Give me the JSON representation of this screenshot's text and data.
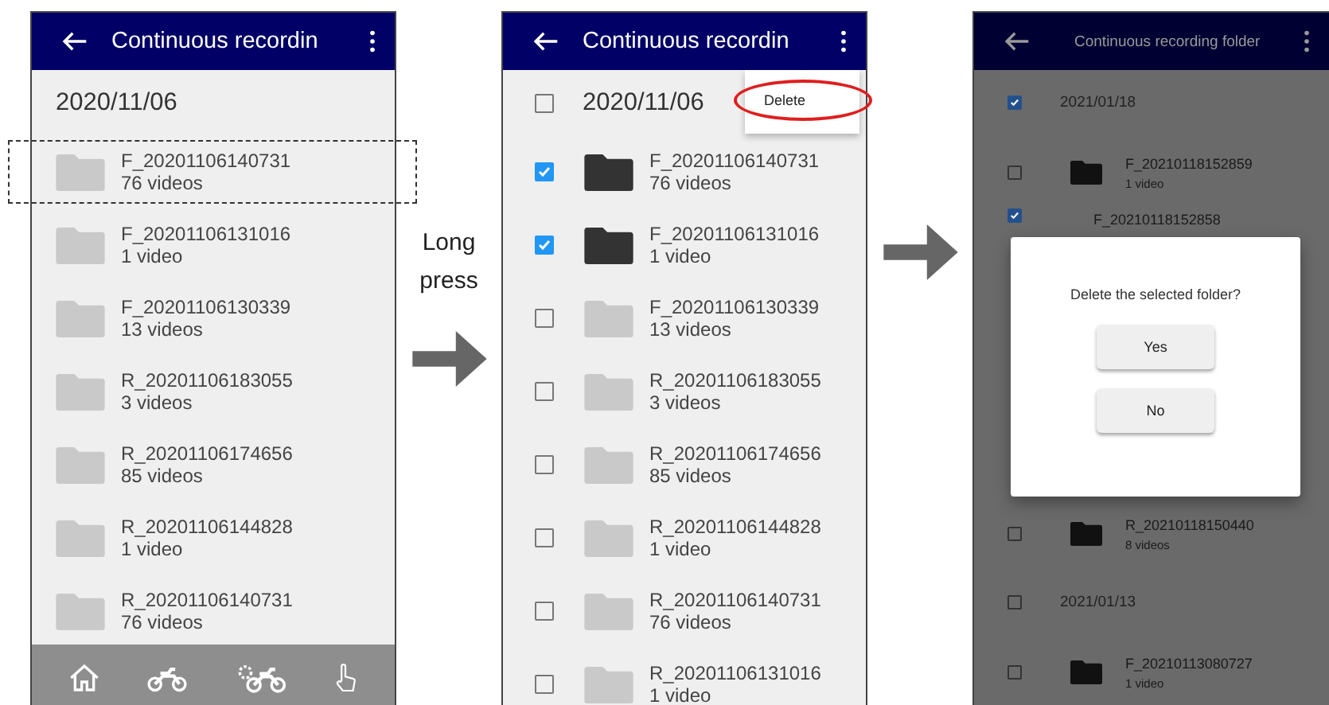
{
  "screens": [
    {
      "kind": "plain",
      "title": "Continuous recordin",
      "nav_bar": true,
      "items": [
        {
          "kind": "date",
          "label": "2020/11/06"
        },
        {
          "kind": "folder",
          "name": "F_20201106140731",
          "count": "76 videos",
          "highlighted": true
        },
        {
          "kind": "folder",
          "name": "F_20201106131016",
          "count": "1 video",
          "highlighted": false
        },
        {
          "kind": "folder",
          "name": "F_20201106130339",
          "count": "13 videos",
          "highlighted": false
        },
        {
          "kind": "folder",
          "name": "R_20201106183055",
          "count": "3 videos",
          "highlighted": false
        },
        {
          "kind": "folder",
          "name": "R_20201106174656",
          "count": "85 videos",
          "highlighted": false
        },
        {
          "kind": "folder",
          "name": "R_20201106144828",
          "count": "1 video",
          "highlighted": false
        },
        {
          "kind": "folder",
          "name": "R_20201106140731",
          "count": "76 videos",
          "highlighted": false
        }
      ]
    },
    {
      "kind": "select",
      "title": "Continuous recordin",
      "menu": [
        {
          "label": "Delete",
          "circled": true
        }
      ],
      "items": [
        {
          "kind": "date",
          "label": "2020/11/06",
          "checked": false
        },
        {
          "kind": "folder",
          "name": "F_20201106140731",
          "count": "76 videos",
          "checked": true
        },
        {
          "kind": "folder",
          "name": "F_20201106131016",
          "count": "1 video",
          "checked": true
        },
        {
          "kind": "folder",
          "name": "F_20201106130339",
          "count": "13 videos",
          "checked": false
        },
        {
          "kind": "folder",
          "name": "R_20201106183055",
          "count": "3 videos",
          "checked": false
        },
        {
          "kind": "folder",
          "name": "R_20201106174656",
          "count": "85 videos",
          "checked": false
        },
        {
          "kind": "folder",
          "name": "R_20201106144828",
          "count": "1 video",
          "checked": false
        },
        {
          "kind": "folder",
          "name": "R_20201106140731",
          "count": "76 videos",
          "checked": false
        },
        {
          "kind": "folder",
          "name": "R_20201106131016",
          "count": "1 video",
          "checked": false
        }
      ]
    },
    {
      "kind": "dialog",
      "title": "Continuous recording folder",
      "items": [
        {
          "kind": "date",
          "label": "2021/01/18",
          "checked": true
        },
        {
          "kind": "folder",
          "name": "F_20210118152859",
          "count": "1 video",
          "checked": false
        },
        {
          "kind": "partial",
          "name": "F_20210118152858",
          "checked": true
        },
        {
          "kind": "folder",
          "name": "R_20210118150440",
          "count": "8 videos",
          "checked": false
        },
        {
          "kind": "date",
          "label": "2021/01/13",
          "checked": false
        },
        {
          "kind": "folder",
          "name": "F_20210113080727",
          "count": "1 video",
          "checked": false
        }
      ],
      "dialog": {
        "message": "Delete the selected folder?",
        "buttons": [
          "Yes",
          "No"
        ]
      }
    }
  ],
  "transitions": [
    {
      "kind": "arrow",
      "caption": "Long press"
    },
    {
      "kind": "arrow"
    }
  ]
}
